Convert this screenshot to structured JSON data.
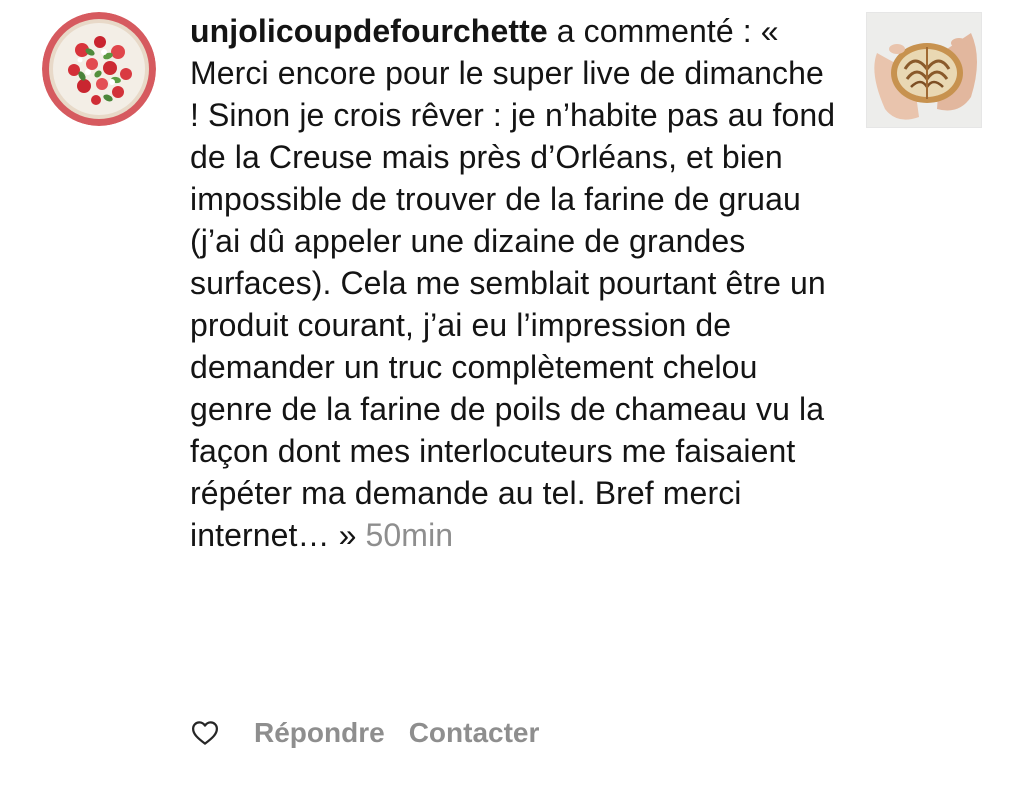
{
  "comment": {
    "username": "unjolicoupdefourchette",
    "action_text": " a commenté : « Merci encore pour le super live de dimanche ! Sinon je crois rêver : je n’habite pas au fond de la Creuse mais près d’Orléans, et bien impossible de trouver de la farine de gruau (j’ai dû appeler une dizaine de grandes surfaces). Cela me semblait pourtant être un produit courant, j’ai eu l’impression de demander un truc complètement chelou genre de la farine de poils de chameau vu la façon dont mes interlocuteurs me faisaient répéter ma demande au tel. Bref merci internet… » ",
    "time": "50min"
  },
  "actions": {
    "like_icon": "heart-outline-icon",
    "reply_label": "Répondre",
    "contact_label": "Contacter"
  },
  "colors": {
    "text": "#141414",
    "muted": "#8e8e8e",
    "avatar_ring": "#d9534f"
  }
}
